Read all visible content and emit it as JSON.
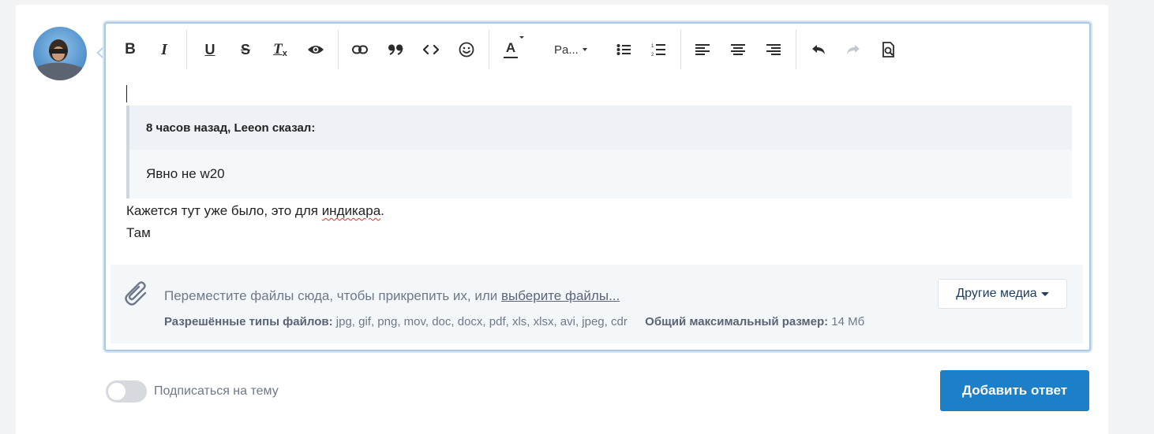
{
  "toolbar": {
    "bold": "B",
    "italic": "I",
    "underline": "U",
    "strike": "S",
    "clear_format": "T",
    "clear_format_sub": "x",
    "text_color": "A",
    "paragraph": "Pa..."
  },
  "editor": {
    "quote": {
      "header": "8 часов назад, Leeon сказал:",
      "body": "Явно не w20"
    },
    "line1_prefix": "Кажется тут уже было, это для ",
    "line1_misspelled": "индикара",
    "line1_suffix": ".",
    "line2": "Там"
  },
  "attachments": {
    "hint_prefix": "Переместите файлы сюда, чтобы прикрепить их, или ",
    "hint_link": "выберите файлы...",
    "allowed_label": "Разрешённые типы файлов:",
    "allowed_types": "jpg, gif, png, mov, doc, docx, pdf, xls, xlsx, avi, jpeg, cdr",
    "max_size_label": "Общий максимальный размер:",
    "max_size_value": "14 Мб",
    "other_media_label": "Другие медиа"
  },
  "footer": {
    "subscribe_label": "Подписаться на тему",
    "subscribe_on": false,
    "submit_label": "Добавить ответ"
  },
  "colors": {
    "accent": "#1e7fc9",
    "editor_border": "#a9c9e6"
  }
}
